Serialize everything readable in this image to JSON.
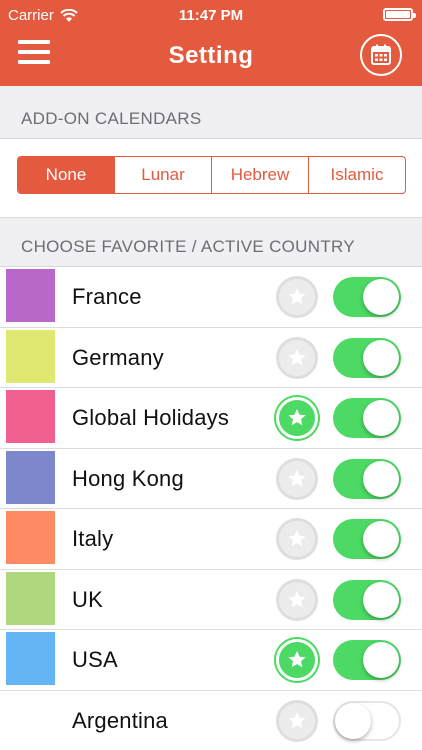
{
  "status_bar": {
    "carrier": "Carrier",
    "time": "11:47 PM",
    "battery_level": 1.0
  },
  "header": {
    "title": "Setting",
    "menu_icon": "hamburger-icon",
    "action_icon": "calendar-icon",
    "color": "#e45a3e"
  },
  "addon": {
    "heading": "ADD-ON CALENDARS",
    "options": [
      {
        "label": "None",
        "selected": true
      },
      {
        "label": "Lunar",
        "selected": false
      },
      {
        "label": "Hebrew",
        "selected": false
      },
      {
        "label": "Islamic",
        "selected": false
      }
    ]
  },
  "countries": {
    "heading": "CHOOSE FAVORITE / ACTIVE COUNTRY",
    "items": [
      {
        "name": "France",
        "color": "#b768c9",
        "favorite": false,
        "active": true
      },
      {
        "name": "Germany",
        "color": "#dfe870",
        "favorite": false,
        "active": true
      },
      {
        "name": "Global Holidays",
        "color": "#f2608f",
        "favorite": true,
        "active": true
      },
      {
        "name": "Hong Kong",
        "color": "#7e86cc",
        "favorite": false,
        "active": true
      },
      {
        "name": "Italy",
        "color": "#fd8a62",
        "favorite": false,
        "active": true
      },
      {
        "name": "UK",
        "color": "#aed77e",
        "favorite": false,
        "active": true
      },
      {
        "name": "USA",
        "color": "#64b5f5",
        "favorite": true,
        "active": true
      },
      {
        "name": "Argentina",
        "color": "#ffffff",
        "favorite": false,
        "active": false
      }
    ]
  }
}
